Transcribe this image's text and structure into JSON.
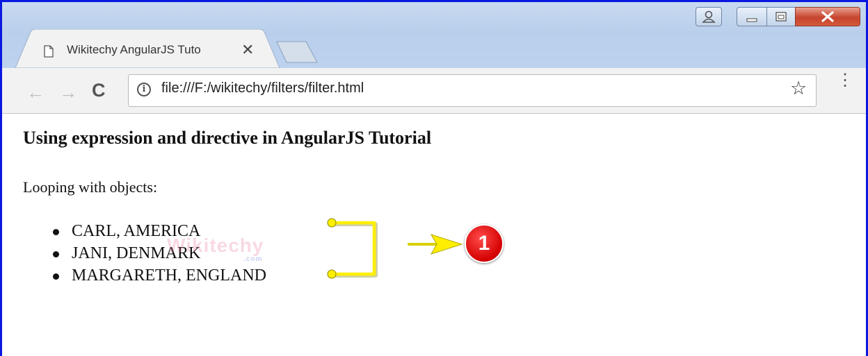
{
  "window": {
    "buttons": {
      "user": "user-icon",
      "minimize": "minimize-icon",
      "maximize": "maximize-icon",
      "close": "close-icon"
    }
  },
  "tab": {
    "title": "Wikitechy AngularJS Tuto",
    "close_glyph": "✕"
  },
  "toolbar": {
    "back_glyph": "←",
    "forward_glyph": "→",
    "reload_glyph": "C",
    "info_glyph": "i",
    "url": "file:///F:/wikitechy/filters/filter.html",
    "star_glyph": "☆",
    "menu_glyph": "⋮"
  },
  "page": {
    "heading": "Using expression and directive in AngularJS Tutorial",
    "paragraph": "Looping with objects:",
    "items": [
      "CARL, AMERICA",
      "JANI, DENMARK",
      "MARGARETH, ENGLAND"
    ]
  },
  "watermark": {
    "text": "Wikitechy",
    "sub": ".com"
  },
  "annotation": {
    "badge": "1",
    "color": "#ffff00"
  }
}
